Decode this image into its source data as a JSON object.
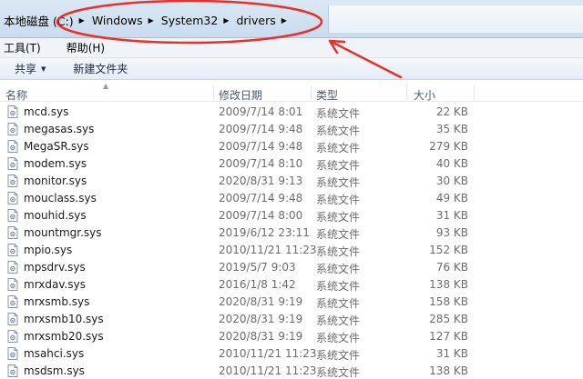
{
  "address": {
    "root": "本地磁盘 (C:)",
    "crumbs": [
      "Windows",
      "System32",
      "drivers"
    ]
  },
  "menu": {
    "tools": "工具(T)",
    "help": "帮助(H)"
  },
  "commands": {
    "share": "共享",
    "new_folder": "新建文件夹"
  },
  "columns": {
    "name": "名称",
    "date": "修改日期",
    "type": "类型",
    "size": "大小"
  },
  "files": [
    {
      "name": "mcd.sys",
      "date": "2009/7/14 8:01",
      "type": "系统文件",
      "size": "22 KB"
    },
    {
      "name": "megasas.sys",
      "date": "2009/7/14 9:48",
      "type": "系统文件",
      "size": "35 KB"
    },
    {
      "name": "MegaSR.sys",
      "date": "2009/7/14 9:48",
      "type": "系统文件",
      "size": "279 KB"
    },
    {
      "name": "modem.sys",
      "date": "2009/7/14 8:10",
      "type": "系统文件",
      "size": "40 KB"
    },
    {
      "name": "monitor.sys",
      "date": "2020/8/31 9:13",
      "type": "系统文件",
      "size": "30 KB"
    },
    {
      "name": "mouclass.sys",
      "date": "2009/7/14 9:48",
      "type": "系统文件",
      "size": "49 KB"
    },
    {
      "name": "mouhid.sys",
      "date": "2009/7/14 8:00",
      "type": "系统文件",
      "size": "31 KB"
    },
    {
      "name": "mountmgr.sys",
      "date": "2019/6/12 23:11",
      "type": "系统文件",
      "size": "93 KB"
    },
    {
      "name": "mpio.sys",
      "date": "2010/11/21 11:23",
      "type": "系统文件",
      "size": "152 KB"
    },
    {
      "name": "mpsdrv.sys",
      "date": "2019/5/7 9:03",
      "type": "系统文件",
      "size": "76 KB"
    },
    {
      "name": "mrxdav.sys",
      "date": "2016/1/8 1:42",
      "type": "系统文件",
      "size": "138 KB"
    },
    {
      "name": "mrxsmb.sys",
      "date": "2020/8/31 9:19",
      "type": "系统文件",
      "size": "158 KB"
    },
    {
      "name": "mrxsmb10.sys",
      "date": "2020/8/31 9:19",
      "type": "系统文件",
      "size": "285 KB"
    },
    {
      "name": "mrxsmb20.sys",
      "date": "2020/8/31 9:19",
      "type": "系统文件",
      "size": "127 KB"
    },
    {
      "name": "msahci.sys",
      "date": "2010/11/21 11:23",
      "type": "系统文件",
      "size": "31 KB"
    },
    {
      "name": "msdsm.sys",
      "date": "2010/11/21 11:23",
      "type": "系统文件",
      "size": "138 KB"
    }
  ],
  "colors": {
    "annotation": "#e8302a",
    "chrome": "#c9dbee"
  }
}
